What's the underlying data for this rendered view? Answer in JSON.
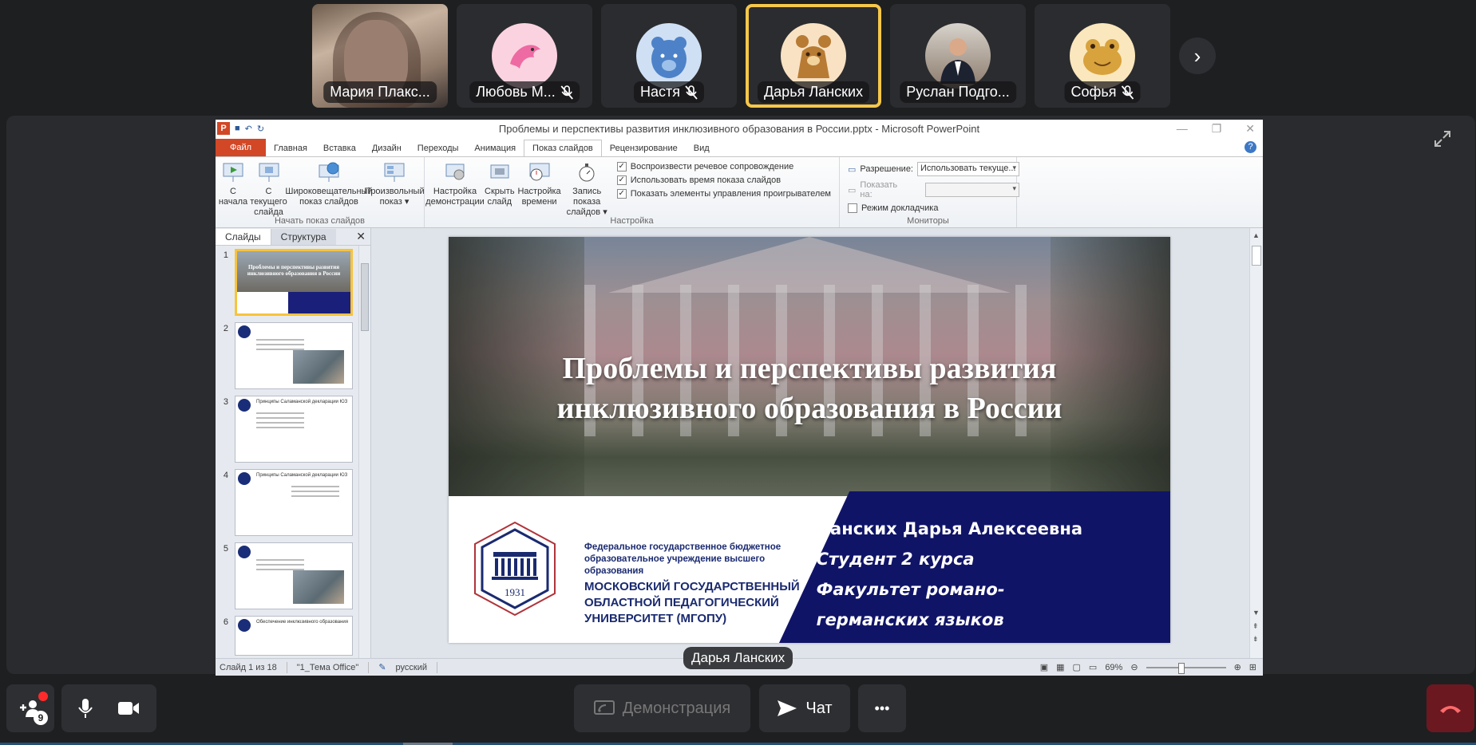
{
  "participants": [
    {
      "name": "Мария Плакс...",
      "type": "video",
      "muted": false,
      "active": false
    },
    {
      "name": "Любовь М...",
      "type": "avatar",
      "animal": "dolphin-icon",
      "bg": "#fbd3e0",
      "muted": true,
      "active": false
    },
    {
      "name": "Настя",
      "type": "avatar",
      "animal": "bear-blue-icon",
      "bg": "#cfe0f4",
      "muted": true,
      "active": false
    },
    {
      "name": "Дарья Ланских",
      "type": "avatar",
      "animal": "bear-brown-icon",
      "bg": "#f9e2c3",
      "muted": false,
      "active": true
    },
    {
      "name": "Руслан Подго...",
      "type": "photo",
      "muted": false,
      "active": false
    },
    {
      "name": "Софья",
      "type": "avatar",
      "animal": "frog-icon",
      "bg": "#fbe7bd",
      "muted": true,
      "active": false
    }
  ],
  "ppt": {
    "window_title": "Проблемы и перспективы развития инклюзивного образования в России.pptx - Microsoft PowerPoint",
    "tabs": [
      "Файл",
      "Главная",
      "Вставка",
      "Дизайн",
      "Переходы",
      "Анимация",
      "Показ слайдов",
      "Рецензирование",
      "Вид"
    ],
    "selected_tab": "Показ слайдов",
    "help": "?",
    "ribbon": {
      "start_group": {
        "name": "Начать показ слайдов",
        "buttons": [
          "С начала",
          "С текущего слайда",
          "Широковещательный показ слайдов",
          "Произвольный показ ▾"
        ]
      },
      "setup_group": {
        "name": "Настройка",
        "buttons": [
          "Настройка демонстрации",
          "Скрыть слайд",
          "Настройка времени",
          "Запись показа слайдов ▾"
        ],
        "checks": [
          "Воспроизвести речевое сопровождение",
          "Использовать время показа слайдов",
          "Показать элементы управления проигрывателем"
        ]
      },
      "monitors_group": {
        "name": "Мониторы",
        "resolution_label": "Разрешение:",
        "resolution_value": "Использовать текуще...",
        "show_on_label": "Показать на:",
        "presenter_mode": "Режим докладчика"
      }
    },
    "pane_tabs": [
      "Слайды",
      "Структура"
    ],
    "thumbnails": [
      {
        "num": "1",
        "title": "Проблемы и перспективы развития инклюзивного образования в России"
      },
      {
        "num": "2",
        "title": ""
      },
      {
        "num": "3",
        "title": "Принципы Саламанской декларации ЮЗ"
      },
      {
        "num": "4",
        "title": "Принципы Саламанской декларации ЮЗ"
      },
      {
        "num": "5",
        "title": ""
      },
      {
        "num": "6",
        "title": "Обеспечение инклюзивного образования"
      }
    ],
    "slide": {
      "title_line1": "Проблемы и перспективы развития",
      "title_line2": "инклюзивного образования в России",
      "author_name": "Ланских Дарья Алексеевна",
      "author_course": "Студент 2 курса",
      "author_faculty1": "Факультет романо-",
      "author_faculty2": "германских языков",
      "org_small": "Федеральное государственное бюджетное образовательное учреждение высшего образования",
      "org_big": "МОСКОВСКИЙ ГОСУДАРСТВЕННЫЙ ОБЛАСТНОЙ ПЕДАГОГИЧЕСКИЙ УНИВЕРСИТЕТ (МГОПУ)",
      "emblem_year": "1931"
    },
    "status": {
      "slide_info": "Слайд 1 из 18",
      "theme": "\"1_Тема Office\"",
      "language": "русский",
      "zoom": "69%"
    }
  },
  "speaker_label": "Дарья Ланских",
  "controls": {
    "participants_count": "9",
    "demo_label": "Демонстрация",
    "chat_label": "Чат",
    "more_label": "•••"
  },
  "colors": {
    "accent_active": "#f5c74a",
    "hangup": "#6b1820",
    "slide_navy": "#101467",
    "ppt_file_tab": "#d24726"
  }
}
